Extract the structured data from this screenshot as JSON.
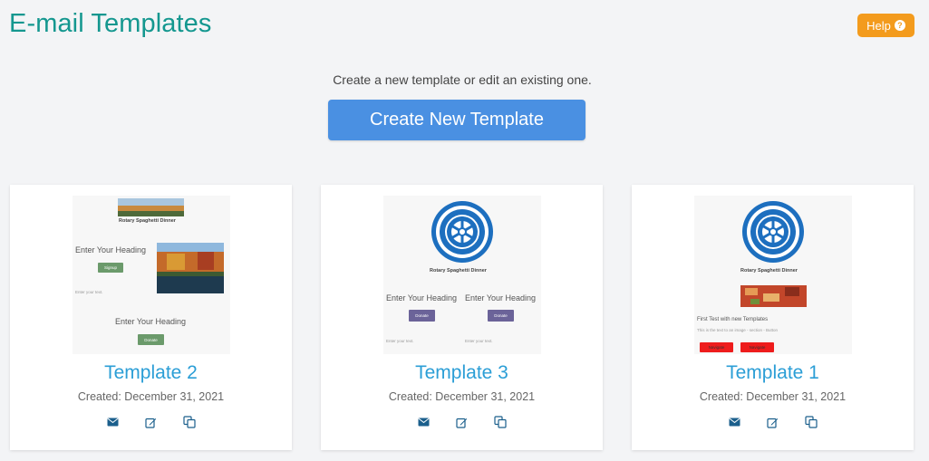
{
  "header": {
    "title": "E-mail Templates",
    "help_label": "Help",
    "help_icon": "question-circle-icon"
  },
  "intro": {
    "subtitle": "Create a new template or edit an existing one.",
    "create_label": "Create New Template"
  },
  "colors": {
    "title": "#14978f",
    "help": "#f39b1d",
    "primary": "#4a90e2",
    "link": "#2b9ed6"
  },
  "templates": [
    {
      "name": "Template 2",
      "created": "Created: December 31, 2021",
      "preview": {
        "title": "Rotary Spaghetti Dinner",
        "heading1": "Enter Your Heading",
        "button1": "Signup",
        "body_text": "Enter your text.",
        "heading2": "Enter Your Heading",
        "button2": "Donate"
      }
    },
    {
      "name": "Template 3",
      "created": "Created: December 31, 2021",
      "preview": {
        "title": "Rotary Spaghetti Dinner",
        "heading_left": "Enter Your Heading",
        "heading_right": "Enter Your Heading",
        "button_left": "Donate",
        "button_right": "Donate",
        "text_left": "Enter your text.",
        "text_right": "Enter your text."
      }
    },
    {
      "name": "Template 1",
      "created": "Created: December 31, 2021",
      "preview": {
        "title": "Rotary Spaghetti Dinner",
        "body_heading": "First Test with new Templates",
        "body_text": "This is the text to an image - section - Button",
        "button_left": "Navigate",
        "button_right": "Navigate"
      }
    }
  ],
  "action_icons": [
    "email-icon",
    "edit-icon",
    "copy-icon"
  ]
}
